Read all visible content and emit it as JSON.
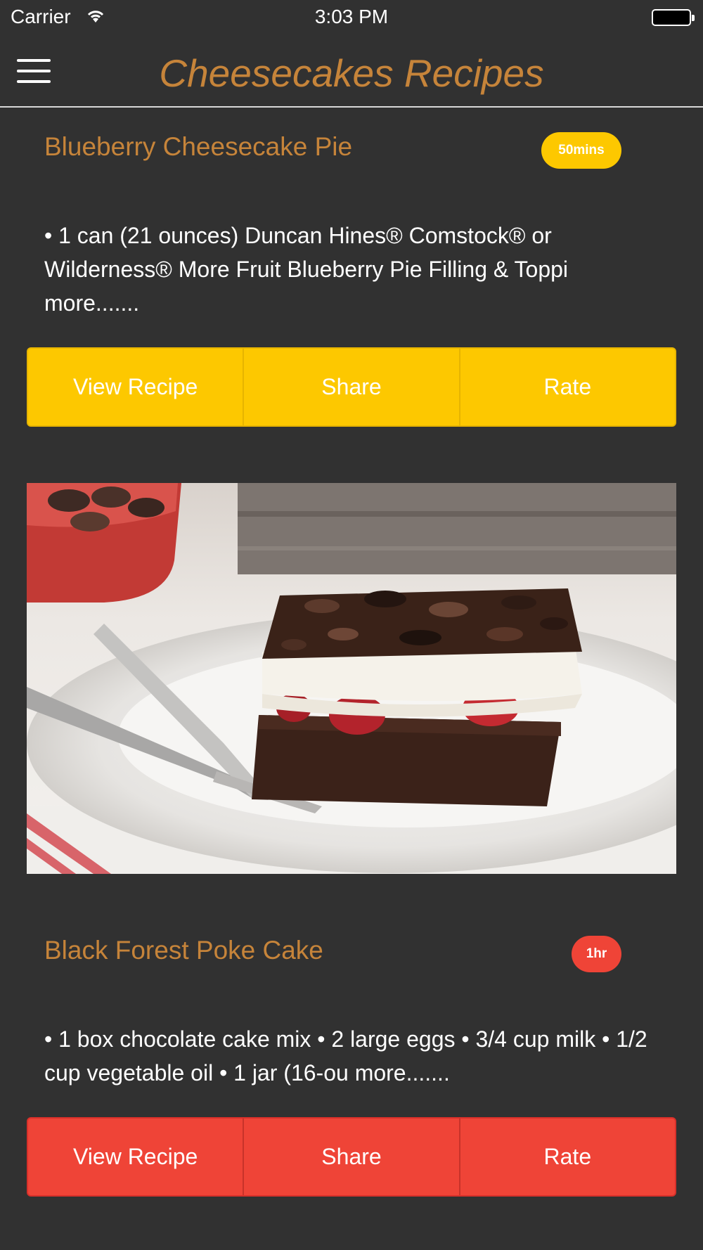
{
  "status_bar": {
    "carrier": "Carrier",
    "time": "3:03 PM"
  },
  "nav": {
    "title": "Cheesecakes Recipes"
  },
  "recipes": [
    {
      "title": "Blueberry Cheesecake Pie",
      "time": "50mins",
      "badge_color": "#fdc800",
      "ingredients": "• 1 can (21 ounces) Duncan Hines® Comstock® or Wilderness® More Fruit Blueberry Pie Filling & Toppi more.......",
      "buttons": {
        "view": "View Recipe",
        "share": "Share",
        "rate": "Rate"
      }
    },
    {
      "title": "Black Forest Poke Cake",
      "time": "1hr",
      "badge_color": "#ef4437",
      "ingredients": "• 1 box chocolate cake mix • 2 large eggs • 3/4 cup milk • 1/2 cup vegetable oil • 1 jar (16-ou more.......",
      "buttons": {
        "view": "View Recipe",
        "share": "Share",
        "rate": "Rate"
      }
    }
  ],
  "colors": {
    "background": "#313131",
    "accent": "#c6843a",
    "yellow": "#fdc800",
    "red": "#ef4437"
  },
  "icons": {
    "menu": "hamburger-menu-icon",
    "wifi": "wifi-icon",
    "battery": "battery-icon"
  }
}
